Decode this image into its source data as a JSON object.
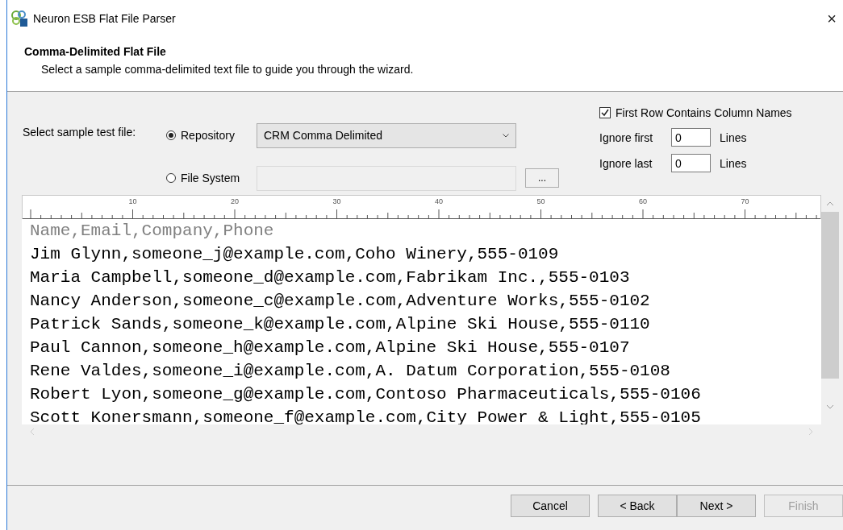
{
  "window": {
    "title": "Neuron ESB Flat File Parser",
    "close": "×"
  },
  "header": {
    "title": "Comma-Delimited Flat File",
    "subtitle": "Select a sample comma-delimited text file to guide you through the wizard."
  },
  "source": {
    "label": "Select sample test file:",
    "options": [
      {
        "label": "Repository",
        "selected": true
      },
      {
        "label": "File System",
        "selected": false
      }
    ],
    "repository_value": "CRM Comma Delimited",
    "browse": "..."
  },
  "first_row_names": {
    "label": "First Row Contains Column Names",
    "checked": true
  },
  "ignore": [
    {
      "label": "Ignore first",
      "value": "0",
      "unit": "Lines"
    },
    {
      "label": "Ignore last",
      "value": "0",
      "unit": "Lines"
    }
  ],
  "ruler": [
    "10",
    "20",
    "30",
    "40",
    "50",
    "60",
    "70"
  ],
  "preview": {
    "header_line": "Name,Email,Company,Phone",
    "lines": [
      "Jim Glynn,someone_j@example.com,Coho Winery,555-0109",
      "Maria Campbell,someone_d@example.com,Fabrikam Inc.,555-0103",
      "Nancy Anderson,someone_c@example.com,Adventure Works,555-0102",
      "Patrick Sands,someone_k@example.com,Alpine Ski House,555-0110",
      "Paul Cannon,someone_h@example.com,Alpine Ski House,555-0107",
      "Rene Valdes,someone_i@example.com,A. Datum Corporation,555-0108",
      "Robert Lyon,someone_g@example.com,Contoso Pharmaceuticals,555-0106",
      "Scott Konersmann,someone_f@example.com,City Power & Light,555-0105"
    ]
  },
  "buttons": [
    {
      "label": "Cancel",
      "disabled": false
    },
    {
      "label": "< Back",
      "disabled": false
    },
    {
      "label": "Next >",
      "disabled": false
    },
    {
      "label": "Finish",
      "disabled": true
    }
  ]
}
